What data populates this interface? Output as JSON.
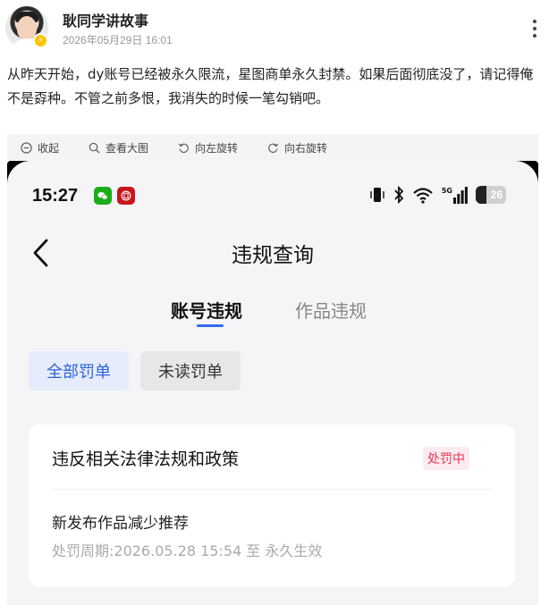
{
  "author": {
    "name": "耿同学讲故事",
    "time": "2026年05月29日 16:01"
  },
  "post": {
    "text": "从昨天开始，dy账号已经被永久限流，星图商单永久封禁。如果后面彻底没了，请记得俺不是孬种。不管之前多恨，我消失的时候一笔勾销吧。"
  },
  "toolbar": {
    "collapse": "收起",
    "view_large": "查看大图",
    "rotate_left": "向左旋转",
    "rotate_right": "向右旋转"
  },
  "phone": {
    "status": {
      "time": "15:27",
      "network": "5G",
      "battery": "26"
    },
    "page_title": "违规查询",
    "tabs": {
      "account": "账号违规",
      "works": "作品违规"
    },
    "filters": {
      "all": "全部罚单",
      "unread": "未读罚单"
    },
    "card": {
      "title": "违反相关法律法规和政策",
      "status": "处罚中",
      "measure": "新发布作品减少推荐",
      "period": "处罚周期:2026.05.28 15:54 至 永久生效"
    }
  },
  "colors": {
    "accent": "#2e6bf0",
    "status_red": "#ec3355",
    "verify_badge": "#ffc300"
  },
  "icons": [
    "verify-badge-icon",
    "more-icon",
    "collapse-icon",
    "zoom-icon",
    "rotate-left-icon",
    "rotate-right-icon",
    "wechat-icon",
    "bank-app-icon",
    "vibrate-icon",
    "bluetooth-icon",
    "wifi-icon",
    "signal-icon",
    "battery-icon",
    "back-arrow-icon"
  ]
}
